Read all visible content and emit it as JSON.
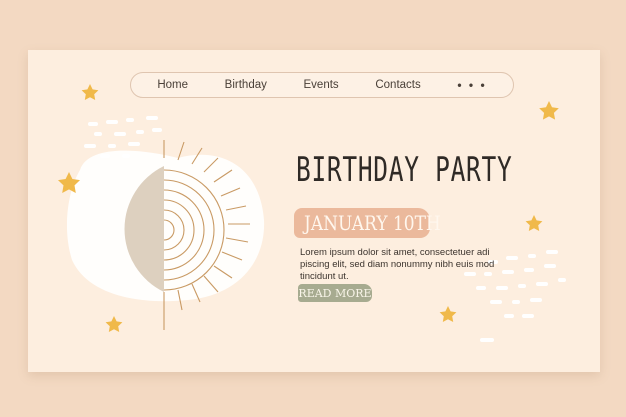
{
  "nav": {
    "items": [
      {
        "label": "Home"
      },
      {
        "label": "Birthday"
      },
      {
        "label": "Events"
      },
      {
        "label": "Contacts"
      }
    ],
    "more_label": "• • •"
  },
  "hero": {
    "title": "BIRTHDAY PARTY",
    "date": "JANUARY 10TH",
    "body": "Lorem ipsum dolor sit amet, consectetuer adi piscing elit, sed diam nonummy nibh euis mod tincidunt ut.",
    "cta": "READ MORE"
  },
  "colors": {
    "background": "#f3d9c2",
    "card": "#fdeedf",
    "accent_peach": "#e9b395",
    "accent_sage": "#a7ab90",
    "star": "#f0b94a",
    "moon": "#ddd0bf",
    "sun_lines": "#c99a64"
  },
  "icons": [
    "star-icon",
    "moon-illustration",
    "sun-rays-illustration",
    "more-dots-icon"
  ]
}
